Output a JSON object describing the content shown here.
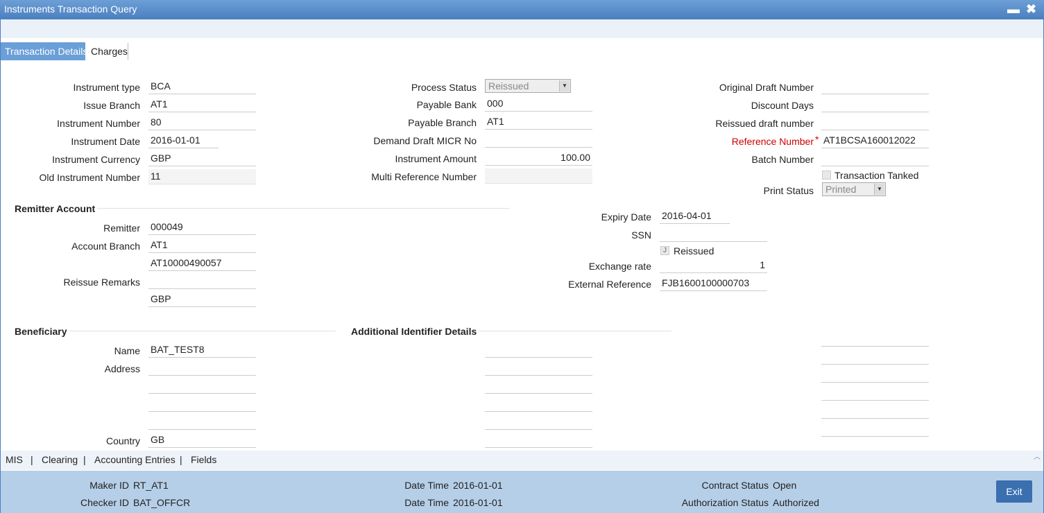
{
  "window": {
    "title": "Instruments Transaction Query",
    "minimize": "▬",
    "close": "✖"
  },
  "tabs": [
    {
      "label": "Transaction Details"
    },
    {
      "label": "Charges"
    }
  ],
  "col1": {
    "instrument_type": {
      "label": "Instrument type",
      "value": "BCA"
    },
    "issue_branch": {
      "label": "Issue Branch",
      "value": "AT1"
    },
    "instrument_number": {
      "label": "Instrument Number",
      "value": "80"
    },
    "instrument_date": {
      "label": "Instrument Date",
      "value": "2016-01-01"
    },
    "instrument_currency": {
      "label": "Instrument Currency",
      "value": "GBP"
    },
    "old_instrument_number": {
      "label": "Old Instrument Number",
      "value": "11"
    }
  },
  "col2": {
    "process_status": {
      "label": "Process Status",
      "value": "Reissued"
    },
    "payable_bank": {
      "label": "Payable Bank",
      "value": "000"
    },
    "payable_branch": {
      "label": "Payable Branch",
      "value": "AT1"
    },
    "demand_draft_micr": {
      "label": "Demand Draft MICR No",
      "value": ""
    },
    "instrument_amount": {
      "label": "Instrument Amount",
      "value": "100.00"
    },
    "multi_reference_number": {
      "label": "Multi Reference Number",
      "value": ""
    }
  },
  "col3": {
    "original_draft_number": {
      "label": "Original Draft Number",
      "value": ""
    },
    "discount_days": {
      "label": "Discount Days",
      "value": ""
    },
    "reissued_draft_number": {
      "label": "Reissued draft number",
      "value": ""
    },
    "reference_number": {
      "label": "Reference Number",
      "required": "*",
      "value": "AT1BCSA160012022"
    },
    "batch_number": {
      "label": "Batch Number",
      "value": ""
    },
    "transaction_tanked": {
      "label": "Transaction Tanked"
    },
    "print_status": {
      "label": "Print Status",
      "value": "Printed"
    }
  },
  "remitter": {
    "heading": "Remitter Account",
    "remitter": {
      "label": "Remitter",
      "value": "000049"
    },
    "account_branch": {
      "label": "Account Branch",
      "value": "AT1"
    },
    "account": {
      "value": "AT10000490057"
    },
    "reissue_remarks": {
      "label": "Reissue Remarks",
      "value": ""
    },
    "currency": {
      "value": "GBP"
    },
    "expiry_date": {
      "label": "Expiry Date",
      "value": "2016-04-01"
    },
    "ssn": {
      "label": "SSN",
      "value": ""
    },
    "reissued": {
      "label": "Reissued",
      "mark": "J"
    },
    "exchange_rate": {
      "label": "Exchange rate",
      "value": "1"
    },
    "external_reference": {
      "label": "External Reference",
      "value": "FJB1600100000703"
    }
  },
  "beneficiary": {
    "heading": "Beneficiary",
    "name": {
      "label": "Name",
      "value": "BAT_TEST8"
    },
    "address": {
      "label": "Address"
    },
    "country": {
      "label": "Country",
      "value": "GB"
    }
  },
  "additional": {
    "heading": "Additional Identifier Details"
  },
  "bottom_links": [
    "MIS",
    "Clearing",
    "Accounting Entries",
    "Fields"
  ],
  "footer": {
    "maker_id": {
      "label": "Maker ID",
      "value": "RT_AT1"
    },
    "checker_id": {
      "label": "Checker ID",
      "value": "BAT_OFFCR"
    },
    "date_time_1": {
      "label": "Date Time",
      "value": "2016-01-01"
    },
    "date_time_2": {
      "label": "Date Time",
      "value": "2016-01-01"
    },
    "contract_status": {
      "label": "Contract Status",
      "value": "Open"
    },
    "authorization_status": {
      "label": "Authorization Status",
      "value": "Authorized"
    },
    "exit_label": "Exit"
  }
}
